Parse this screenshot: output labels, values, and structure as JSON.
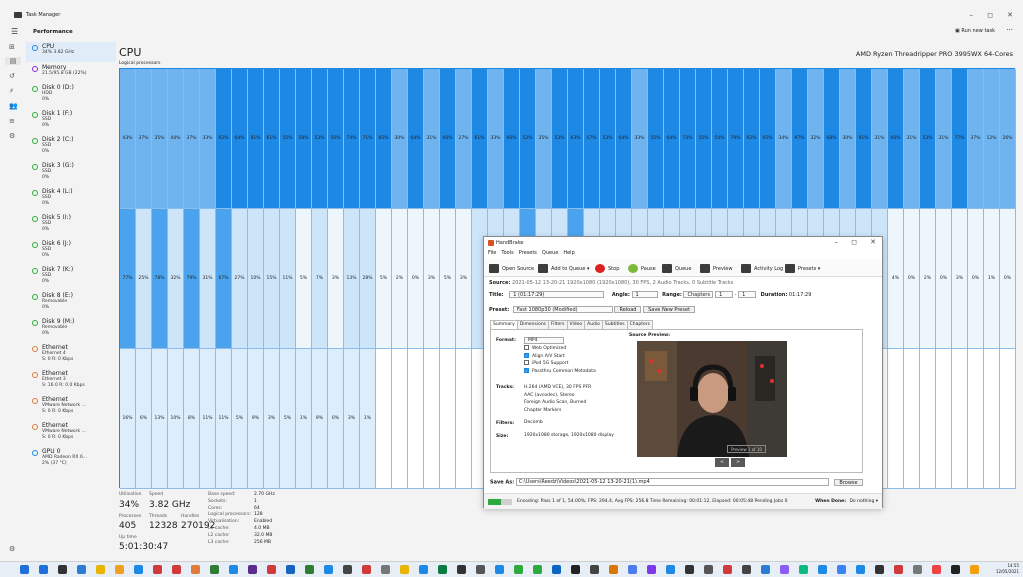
{
  "window": {
    "title": "Task Manager"
  },
  "header": {
    "title": "Performance",
    "run_new_task": "Run new task",
    "more": "···"
  },
  "sidebar": [
    {
      "name": "CPU",
      "sub": [
        "34% 3.82 GHz"
      ],
      "color": "#1e88e5",
      "selected": true
    },
    {
      "name": "Memory",
      "sub": [
        "21.5/95.8 GB (22%)"
      ],
      "color": "#8a2be2"
    },
    {
      "name": "Disk 0 (D:)",
      "sub": [
        "HDD",
        "0%"
      ],
      "color": "#2eaa3c"
    },
    {
      "name": "Disk 1 (F:)",
      "sub": [
        "SSD",
        "0%"
      ],
      "color": "#2eaa3c"
    },
    {
      "name": "Disk 2 (C:)",
      "sub": [
        "SSD",
        "0%"
      ],
      "color": "#2eaa3c"
    },
    {
      "name": "Disk 3 (G:)",
      "sub": [
        "SSD",
        "0%"
      ],
      "color": "#2eaa3c"
    },
    {
      "name": "Disk 4 (L:)",
      "sub": [
        "SSD",
        "0%"
      ],
      "color": "#2eaa3c"
    },
    {
      "name": "Disk 5 (I:)",
      "sub": [
        "SSD",
        "0%"
      ],
      "color": "#2eaa3c"
    },
    {
      "name": "Disk 6 (J:)",
      "sub": [
        "SSD",
        "0%"
      ],
      "color": "#2eaa3c"
    },
    {
      "name": "Disk 7 (K:)",
      "sub": [
        "SSD",
        "0%"
      ],
      "color": "#2eaa3c"
    },
    {
      "name": "Disk 8 (E:)",
      "sub": [
        "Removable",
        "0%"
      ],
      "color": "#2eaa3c"
    },
    {
      "name": "Disk 9 (M:)",
      "sub": [
        "Removable",
        "0%"
      ],
      "color": "#2eaa3c"
    },
    {
      "name": "Ethernet",
      "sub": [
        "Ethernet 4",
        "S: 0 R: 0 Kbps"
      ],
      "color": "#e07b39"
    },
    {
      "name": "Ethernet",
      "sub": [
        "Ethernet 3",
        "S: 16.0 R: 0.0 Kbps"
      ],
      "color": "#e07b39"
    },
    {
      "name": "Ethernet",
      "sub": [
        "VMware Network ...",
        "S: 0 R: 0 Kbps"
      ],
      "color": "#e07b39"
    },
    {
      "name": "Ethernet",
      "sub": [
        "VMware Network ...",
        "S: 0 R: 0 Kbps"
      ],
      "color": "#e07b39"
    },
    {
      "name": "GPU 0",
      "sub": [
        "AMD Radeon RX 6...",
        "2% (37 °C)"
      ],
      "color": "#1e88e5"
    }
  ],
  "cpu": {
    "title": "CPU",
    "subtitle": "Logical processors",
    "processor": "AMD Ryzen Threadripper PRO 3995WX 64-Cores",
    "rows": [
      [
        "43%",
        "37%",
        "35%",
        "44%",
        "37%",
        "33%",
        "62%",
        "64%",
        "81%",
        "61%",
        "55%",
        "58%",
        "53%",
        "56%",
        "74%",
        "71%",
        "85%",
        "30%",
        "64%",
        "31%",
        "60%",
        "27%",
        "61%",
        "33%",
        "66%",
        "52%",
        "35%",
        "53%",
        "63%",
        "57%",
        "53%",
        "64%",
        "33%",
        "55%",
        "64%",
        "73%",
        "55%",
        "54%",
        "79%",
        "62%",
        "65%",
        "34%",
        "97%",
        "32%",
        "68%",
        "30%",
        "91%",
        "31%",
        "60%",
        "31%",
        "53%",
        "31%",
        "77%",
        "37%",
        "12%",
        "26%"
      ],
      [
        "77%",
        "25%",
        "78%",
        "32%",
        "79%",
        "31%",
        "67%",
        "27%",
        "10%",
        "15%",
        "11%",
        "5%",
        "7%",
        "3%",
        "13%",
        "28%",
        "5%",
        "2%",
        "0%",
        "3%",
        "5%",
        "3%",
        "",
        "",
        "",
        "",
        "",
        "",
        "",
        "",
        "",
        "",
        "",
        "",
        "",
        "",
        "",
        "",
        "",
        "",
        "",
        "",
        "",
        "",
        "",
        "",
        "",
        "",
        "4%",
        "0%",
        "2%",
        "0%",
        "3%",
        "0%",
        "1%",
        "0%"
      ],
      [
        "16%",
        "6%",
        "13%",
        "10%",
        "8%",
        "11%",
        "11%",
        "5%",
        "9%",
        "3%",
        "5%",
        "1%",
        "9%",
        "0%",
        "3%",
        "1%"
      ]
    ],
    "row2_levels": [
      0.77,
      0.25,
      0.78,
      0.32,
      0.79,
      0.31,
      0.67,
      0.27,
      0.1,
      0.15,
      0.11,
      0.05,
      0.07,
      0.03,
      0.13,
      0.28,
      0.05,
      0.02,
      0.0,
      0.03,
      0.05,
      0.03,
      0.2,
      0.3,
      0.2,
      0.6,
      0.4,
      0.3,
      0.7,
      0.4,
      0.3,
      0.3,
      0.2,
      0.3,
      0.3,
      0.3,
      0.3,
      0.3,
      0.3,
      0.3,
      0.3,
      0.3,
      0.3,
      0.3,
      0.3,
      0.3,
      0.3,
      0.3,
      0.04,
      0.0,
      0.02,
      0.0,
      0.03,
      0.0,
      0.01,
      0.0
    ],
    "row3_levels": [
      0.16,
      0.06,
      0.13,
      0.1,
      0.08,
      0.11,
      0.11,
      0.05,
      0.09,
      0.03,
      0.05,
      0.01,
      0.09,
      0.0,
      0.03,
      0.01
    ]
  },
  "stats": {
    "utilisation_label": "Utilisation",
    "utilisation": "34%",
    "speed_label": "Speed",
    "speed": "3.82 GHz",
    "processes_label": "Processes",
    "processes": "405",
    "threads_label": "Threads",
    "threads": "12328",
    "handles_label": "Handles",
    "handles": "270192",
    "uptime_label": "Up time",
    "uptime": "5:01:30:47",
    "right": [
      [
        "Base speed:",
        "2.70 GHz"
      ],
      [
        "Sockets:",
        "1"
      ],
      [
        "Cores:",
        "64"
      ],
      [
        "Logical processors:",
        "128"
      ],
      [
        "Virtualisation:",
        "Enabled"
      ],
      [
        "L1 cache:",
        "4.0 MB"
      ],
      [
        "L2 cache:",
        "32.0 MB"
      ],
      [
        "L3 cache:",
        "256 MB"
      ]
    ]
  },
  "handbrake": {
    "title": "HandBrake",
    "menu": [
      "File",
      "Tools",
      "Presets",
      "Queue",
      "Help"
    ],
    "toolbar": [
      "Open Source",
      "Add to Queue ▾",
      "Stop",
      "Pause",
      "Queue",
      "Preview",
      "Activity Log",
      "Presets ▾"
    ],
    "source_label": "Source:",
    "source": "2021-05-12 13-20-21   1920x1080 (1920x1080), 30 FPS, 2 Audio Tracks, 0 Subtitle Tracks",
    "title_label": "Title:",
    "title_value": "1  (01:17:29)",
    "angle_label": "Angle:",
    "angle_value": "1",
    "range_label": "Range:",
    "range_value": "Chapters",
    "range_from": "1",
    "range_to": "1",
    "duration_label": "Duration:",
    "duration": "01:17:29",
    "preset_label": "Preset:",
    "preset_value": "Fast 1080p30 (Modified)",
    "reload": "Reload",
    "save_new_preset": "Save New Preset",
    "tabs": [
      "Summary",
      "Dimensions",
      "Filters",
      "Video",
      "Audio",
      "Subtitles",
      "Chapters"
    ],
    "format_label": "Format:",
    "format_value": "MP4",
    "format_opts": [
      {
        "label": "Web Optimized",
        "on": false
      },
      {
        "label": "Align A/V Start",
        "on": true
      },
      {
        "label": "iPod 5G Support",
        "on": false
      },
      {
        "label": "Passthru Common Metadata",
        "on": true
      }
    ],
    "tracks_label": "Tracks:",
    "tracks": [
      "H.264 (AMD VCE), 30 FPS PFR",
      "AAC (avcodec), Stereo",
      "Foreign Audio Scan, Burned",
      "Chapter Markers"
    ],
    "filters_label": "Filters:",
    "filters": "Decomb",
    "size_label": "Size:",
    "size": "1920x1080 storage, 1920x1080 display",
    "preview_label": "Source Preview:",
    "preview_counter": "Preview 1 of 10",
    "save_as_label": "Save As:",
    "save_path": "C:\\Users\\Reedz\\Videos\\2021-05-12 13-20-21(1).mp4",
    "browse": "Browse",
    "status": "Encoding: Pass 1 of 1,  54.00%, FPS: 294.4,  Avg FPS: 256.8  Time Remaining: 00:01:12,  Elapsed: 00:05:48   Pending Jobs 0",
    "progress": 0.54,
    "when_done_label": "When Done:",
    "when_done": "Do nothing ▾"
  },
  "taskbar": {
    "time": "14:55",
    "date": "12/05/2021"
  }
}
